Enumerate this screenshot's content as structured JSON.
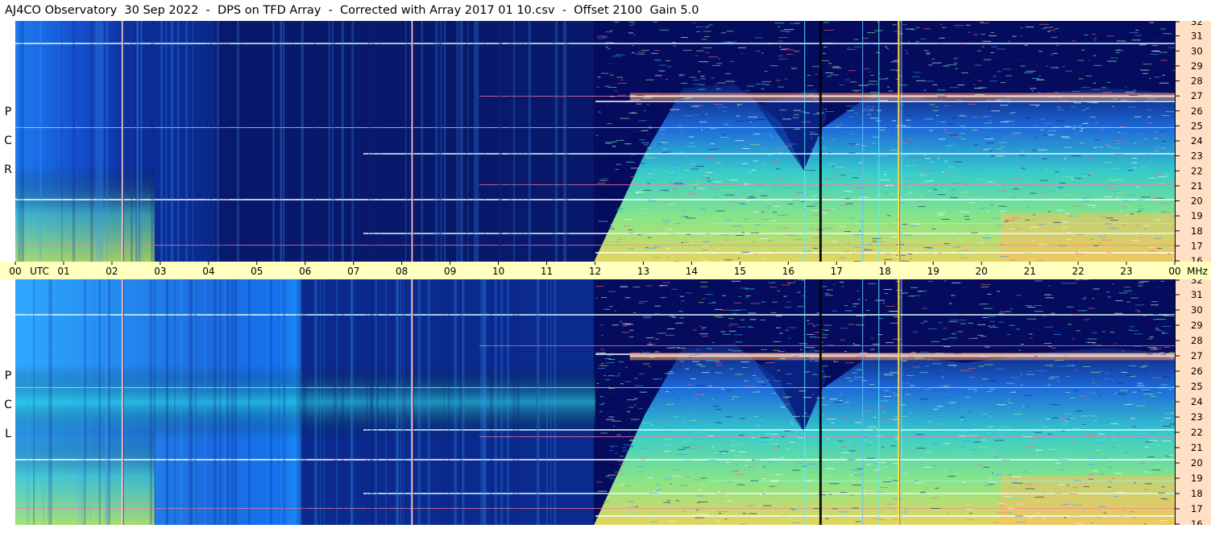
{
  "title": "AJ4CO Observatory  30 Sep 2022  -  DPS on TFD Array  -  Corrected with Array 2017 01 10.csv  -  Offset 2100  Gain 5.0",
  "chart_data": [
    {
      "type": "heatmap",
      "polarization": "RCP",
      "pol_letters": [
        "R",
        "C",
        "P"
      ],
      "x_ticks": [
        "00",
        "01",
        "02",
        "03",
        "04",
        "05",
        "06",
        "07",
        "08",
        "09",
        "10",
        "11",
        "12",
        "13",
        "14",
        "15",
        "16",
        "17",
        "18",
        "19",
        "20",
        "21",
        "22",
        "23",
        "00"
      ],
      "x_unit": "UTC",
      "y_ticks": [
        "16",
        "17",
        "18",
        "19",
        "20",
        "21",
        "22",
        "23",
        "24",
        "25",
        "26",
        "27",
        "28",
        "29",
        "30",
        "31",
        "32"
      ],
      "ylim": [
        16,
        32
      ],
      "y_unit": "MHz"
    },
    {
      "type": "heatmap",
      "polarization": "LCP",
      "pol_letters": [
        "L",
        "C",
        "P"
      ],
      "x_ticks": [
        "00",
        "01",
        "02",
        "03",
        "04",
        "05",
        "06",
        "07",
        "08",
        "09",
        "10",
        "11",
        "12",
        "13",
        "14",
        "15",
        "16",
        "17",
        "18",
        "19",
        "20",
        "21",
        "22",
        "23",
        "00"
      ],
      "x_unit": "UTC",
      "y_ticks": [
        "16",
        "17",
        "18",
        "19",
        "20",
        "21",
        "22",
        "23",
        "24",
        "25",
        "26",
        "27",
        "28",
        "29",
        "30",
        "31",
        "32"
      ],
      "ylim": [
        16,
        32
      ],
      "y_unit": "MHz"
    }
  ],
  "colors": {
    "low": "#08226e",
    "mid": "#1f8fff",
    "high": "#b8ff5a",
    "peak": "#ff6a60",
    "time_axis_bg": "#ffffc0",
    "freq_axis_bg": "#ffe0c4"
  }
}
